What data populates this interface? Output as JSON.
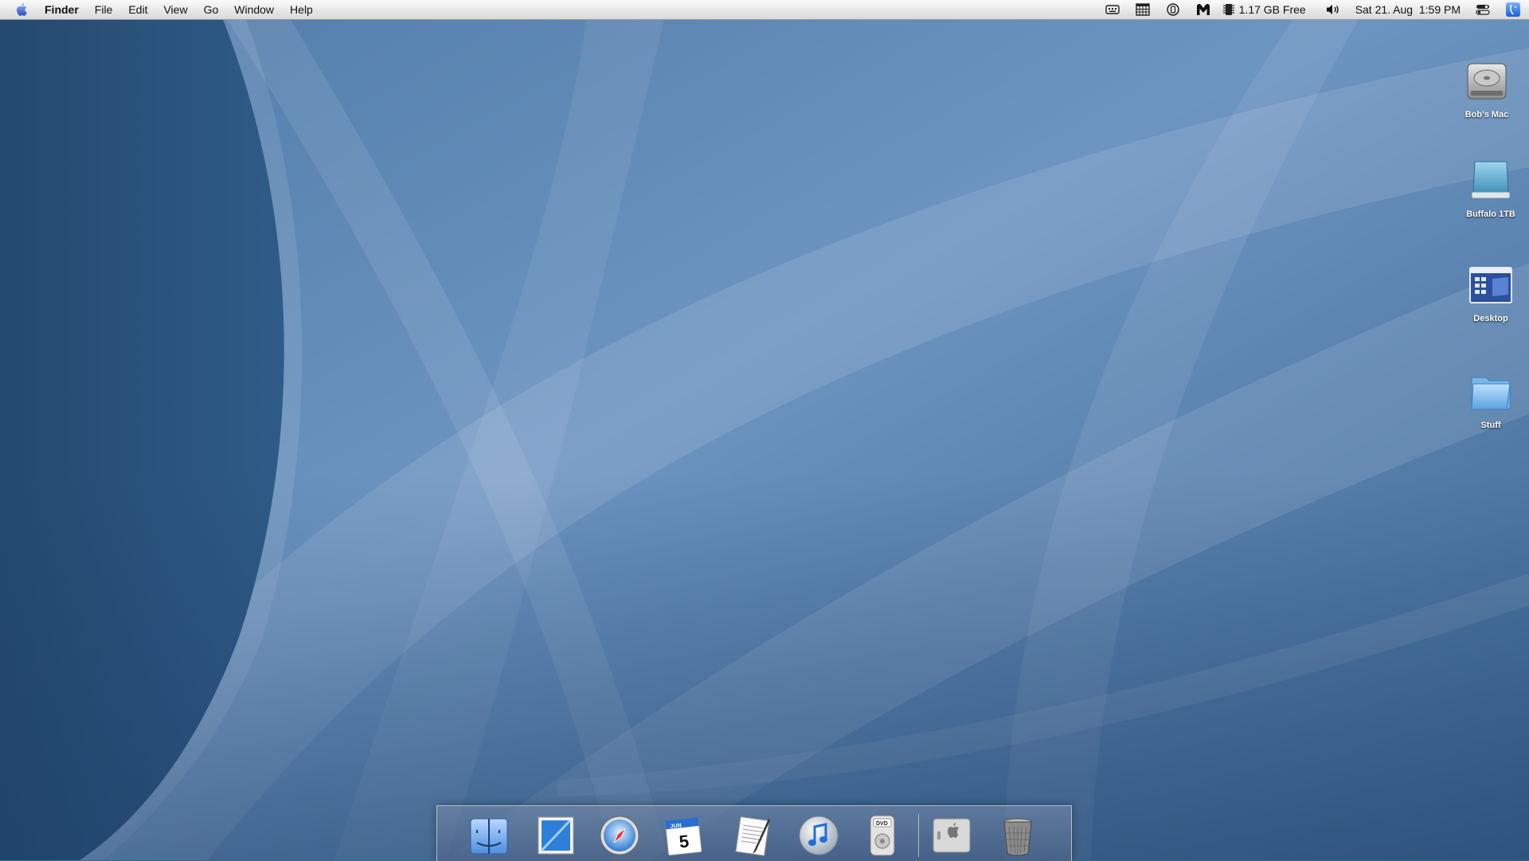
{
  "menubar": {
    "apple_icon": "apple-logo-icon",
    "app_name": "Finder",
    "menus": [
      "File",
      "Edit",
      "View",
      "Go",
      "Window",
      "Help"
    ],
    "status": {
      "icons": [
        "keyboard-icon",
        "calendar-grid-icon",
        "sync-icon",
        "malwarebytes-icon",
        "memory-chip-icon",
        "volume-icon",
        "switch-icon",
        "spotlight-icon"
      ],
      "memory_text": "1.17 GB Free",
      "clock_text": "Sat 21. Aug  1:59 PM"
    }
  },
  "desktop": {
    "icons": [
      {
        "label": "Bob's Mac",
        "icon": "hard-drive-icon"
      },
      {
        "label": "Buffalo 1TB",
        "icon": "external-drive-icon"
      },
      {
        "label": "Desktop",
        "icon": "desktop-folder-icon"
      },
      {
        "label": "Stuff",
        "icon": "folder-icon"
      }
    ]
  },
  "dock": {
    "items": [
      "finder-icon",
      "mail-stamp-icon",
      "safari-compass-icon",
      "ical-calendar-icon",
      "textedit-icon",
      "itunes-icon",
      "dvd-player-icon",
      "system-preferences-icon",
      "trash-icon"
    ],
    "calendar_month": "JUN",
    "calendar_day": "5",
    "dvd_label": "DVD"
  },
  "colors": {
    "wallpaper_base": "#4a76a4",
    "wallpaper_dark": "#26507c",
    "menubar": "#e9e9e9",
    "accent": "#3f7bd7"
  }
}
